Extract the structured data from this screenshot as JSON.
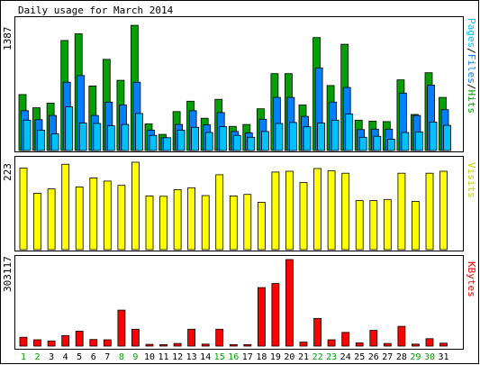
{
  "chart_data": [
    {
      "type": "bar",
      "title": "Daily usage for March 2014",
      "categories": [
        "1",
        "2",
        "3",
        "4",
        "5",
        "6",
        "7",
        "8",
        "9",
        "10",
        "11",
        "12",
        "13",
        "14",
        "15",
        "16",
        "17",
        "18",
        "19",
        "20",
        "21",
        "22",
        "23",
        "24",
        "25",
        "26",
        "27",
        "28",
        "29",
        "30",
        "31"
      ],
      "max_label": "1387",
      "ylim": [
        0,
        1387
      ],
      "legend": [
        "Pages",
        "/",
        "Files",
        "/",
        "Hits"
      ],
      "series": [
        {
          "name": "Hits",
          "color": "#00A000",
          "values": [
            590,
            450,
            500,
            1160,
            1230,
            680,
            960,
            740,
            1320,
            280,
            170,
            410,
            520,
            340,
            540,
            255,
            275,
            440,
            810,
            810,
            480,
            1190,
            685,
            1120,
            320,
            310,
            305,
            745,
            380,
            820,
            560
          ]
        },
        {
          "name": "Files",
          "color": "#0080FF",
          "values": [
            420,
            325,
            370,
            720,
            790,
            370,
            510,
            480,
            720,
            215,
            135,
            275,
            420,
            270,
            400,
            200,
            185,
            330,
            560,
            560,
            360,
            870,
            510,
            665,
            220,
            225,
            225,
            605,
            370,
            690,
            430
          ]
        },
        {
          "name": "Pages",
          "color": "#00C0FF",
          "values": [
            320,
            215,
            175,
            460,
            290,
            285,
            260,
            275,
            390,
            160,
            135,
            215,
            245,
            190,
            250,
            160,
            140,
            200,
            285,
            295,
            250,
            290,
            320,
            385,
            140,
            150,
            120,
            190,
            195,
            300,
            265
          ]
        }
      ]
    },
    {
      "type": "bar",
      "categories": [
        "1",
        "2",
        "3",
        "4",
        "5",
        "6",
        "7",
        "8",
        "9",
        "10",
        "11",
        "12",
        "13",
        "14",
        "15",
        "16",
        "17",
        "18",
        "19",
        "20",
        "21",
        "22",
        "23",
        "24",
        "25",
        "26",
        "27",
        "28",
        "29",
        "30",
        "31"
      ],
      "max_label": "223",
      "ylim": [
        0,
        223
      ],
      "legend": [
        "Visits"
      ],
      "series": [
        {
          "name": "Visits",
          "color": "#FFFF00",
          "values": [
            208,
            144,
            155,
            218,
            160,
            183,
            175,
            164,
            223,
            137,
            136,
            153,
            158,
            138,
            191,
            137,
            141,
            121,
            198,
            200,
            171,
            207,
            201,
            195,
            125,
            125,
            128,
            195,
            123,
            195,
            200
          ]
        }
      ]
    },
    {
      "type": "bar",
      "categories": [
        "1",
        "2",
        "3",
        "4",
        "5",
        "6",
        "7",
        "8",
        "9",
        "10",
        "11",
        "12",
        "13",
        "14",
        "15",
        "16",
        "17",
        "18",
        "19",
        "20",
        "21",
        "22",
        "23",
        "24",
        "25",
        "26",
        "27",
        "28",
        "29",
        "30",
        "31"
      ],
      "max_label": "303117",
      "ylim": [
        0,
        303117
      ],
      "legend": [
        "KBytes"
      ],
      "series": [
        {
          "name": "KBytes",
          "color": "#FF0000",
          "values": [
            31000,
            22000,
            18000,
            37000,
            52000,
            23000,
            22000,
            126000,
            59000,
            6000,
            5000,
            9000,
            59000,
            7000,
            59000,
            5000,
            5000,
            205000,
            219000,
            303117,
            14000,
            97000,
            22000,
            48000,
            11000,
            55000,
            9000,
            69000,
            7000,
            26000,
            10000
          ]
        }
      ]
    }
  ],
  "weekend_days": [
    "1",
    "2",
    "8",
    "9",
    "15",
    "16",
    "22",
    "23",
    "29",
    "30"
  ],
  "colors": {
    "frame": "#000000",
    "panel_bg": "#ffffff",
    "weekday_label": "#000000",
    "weekend_label": "#00A000",
    "visits_legend": "#CCCC00"
  }
}
